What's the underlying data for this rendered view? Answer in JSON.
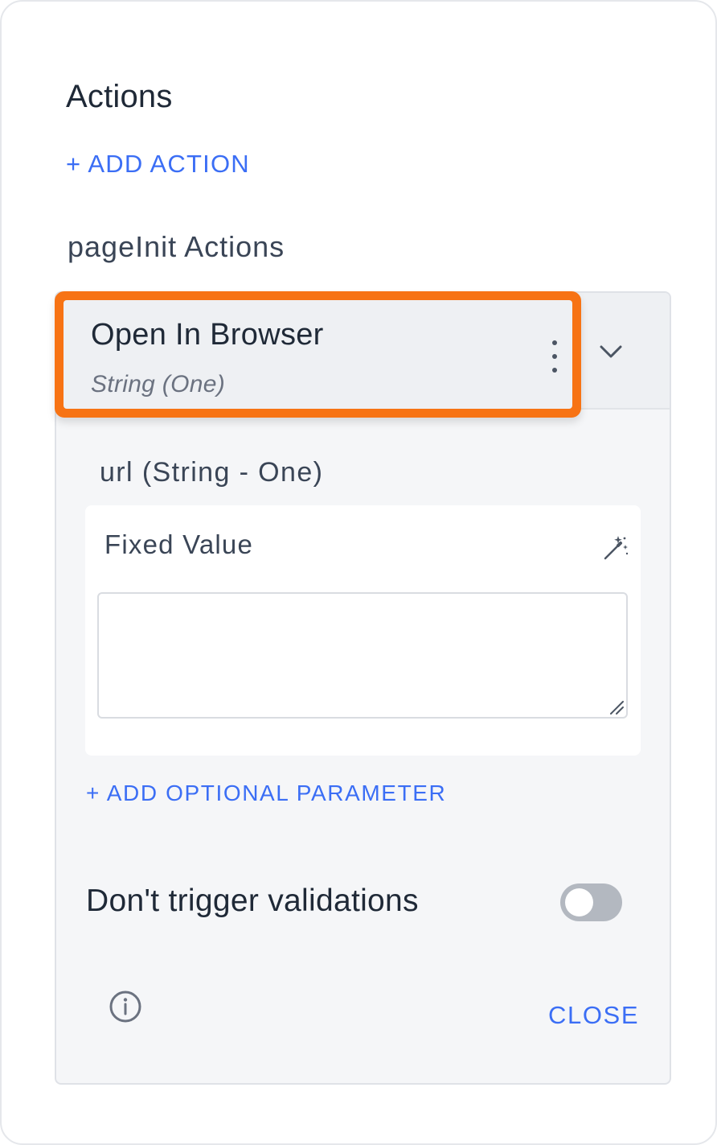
{
  "actions": {
    "title": "Actions",
    "add_action_label": "+ ADD ACTION"
  },
  "page_init": {
    "title": "pageInit Actions"
  },
  "action_item": {
    "name": "Open In Browser",
    "type": "String (One)"
  },
  "parameter": {
    "label": "url (String - One)",
    "mode_label": "Fixed Value",
    "value": ""
  },
  "add_optional_parameter_label": "+ ADD OPTIONAL PARAMETER",
  "validation_toggle": {
    "label": "Don't trigger validations",
    "enabled": false
  },
  "footer": {
    "close_label": "CLOSE"
  },
  "colors": {
    "accent": "#3b6ef5",
    "highlight": "#f77314"
  },
  "icons": [
    "chevron-down-icon",
    "kebab-menu-icon",
    "magic-wand-icon",
    "resize-grip-icon",
    "info-icon"
  ]
}
